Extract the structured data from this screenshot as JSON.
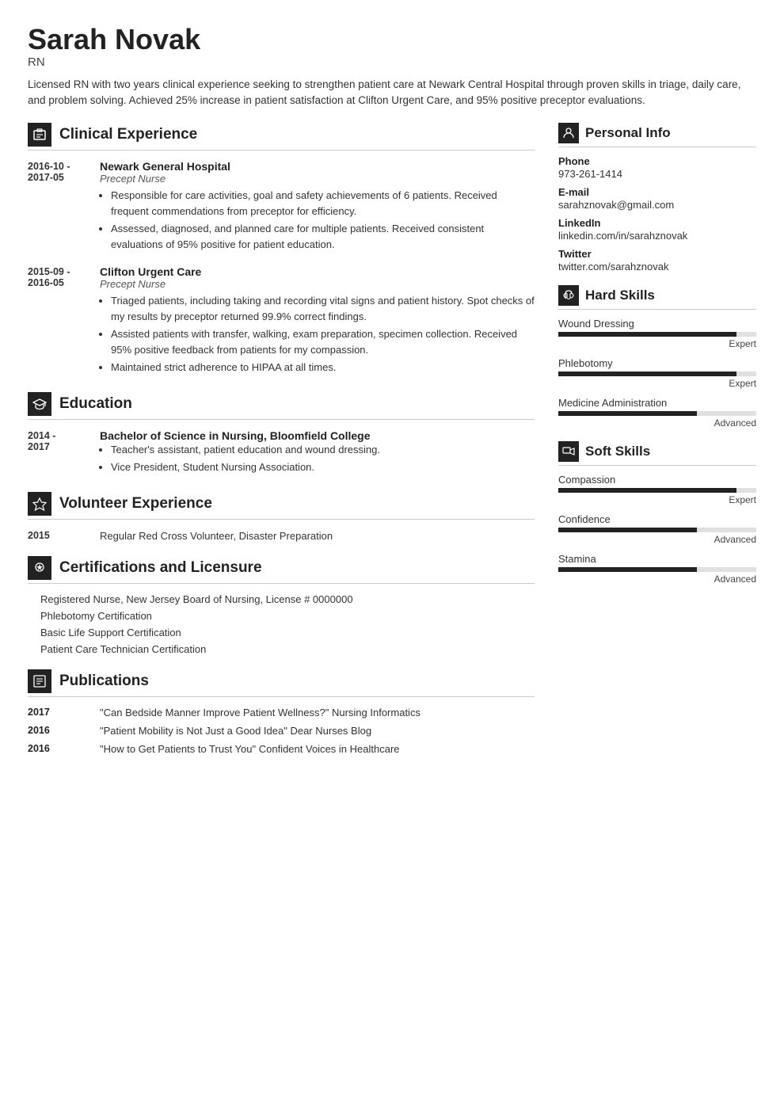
{
  "header": {
    "name": "Sarah Novak",
    "title": "RN",
    "summary": "Licensed RN with two years clinical experience seeking to strengthen patient care at Newark Central Hospital through proven skills in triage, daily care, and problem solving. Achieved 25% increase in patient satisfaction at Clifton Urgent Care, and 95% positive preceptor evaluations."
  },
  "sections": {
    "clinical_experience": {
      "label": "Clinical Experience",
      "entries": [
        {
          "date": "2016-10 -\n2017-05",
          "org": "Newark General Hospital",
          "role": "Precept Nurse",
          "bullets": [
            "Responsible for care activities, goal and safety achievements of 6 patients. Received frequent commendations from preceptor for efficiency.",
            "Assessed, diagnosed, and planned care for multiple patients. Received consistent evaluations of 95% positive for patient education."
          ]
        },
        {
          "date": "2015-09 -\n2016-05",
          "org": "Clifton Urgent Care",
          "role": "Precept Nurse",
          "bullets": [
            "Triaged patients, including taking and recording vital signs and patient history. Spot checks of my results by preceptor returned 99.9% correct findings.",
            "Assisted patients with transfer, walking, exam preparation, specimen collection. Received 95% positive feedback from patients for my compassion.",
            "Maintained strict adherence to HIPAA at all times."
          ]
        }
      ]
    },
    "education": {
      "label": "Education",
      "entries": [
        {
          "date": "2014 -\n2017",
          "org": "Bachelor of Science in Nursing, Bloomfield College",
          "role": "",
          "bullets": [
            "Teacher's assistant, patient education and wound dressing.",
            "Vice President, Student Nursing Association."
          ]
        }
      ]
    },
    "volunteer": {
      "label": "Volunteer Experience",
      "entries": [
        {
          "date": "2015",
          "text": "Regular Red Cross Volunteer, Disaster Preparation"
        }
      ]
    },
    "certifications": {
      "label": "Certifications and Licensure",
      "items": [
        "Registered Nurse, New Jersey Board of Nursing, License # 0000000",
        "Phlebotomy Certification",
        "Basic Life Support Certification",
        "Patient Care Technician Certification"
      ]
    },
    "publications": {
      "label": "Publications",
      "items": [
        {
          "year": "2017",
          "text": "\"Can Bedside Manner Improve Patient Wellness?\" Nursing Informatics"
        },
        {
          "year": "2016",
          "text": "\"Patient Mobility is Not Just a Good Idea\" Dear Nurses Blog"
        },
        {
          "year": "2016",
          "text": "\"How to Get Patients to Trust You\" Confident Voices in Healthcare"
        }
      ]
    }
  },
  "right": {
    "personal_info": {
      "label": "Personal Info",
      "fields": [
        {
          "label": "Phone",
          "value": "973-261-1414"
        },
        {
          "label": "E-mail",
          "value": "sarahznovak@gmail.com"
        },
        {
          "label": "LinkedIn",
          "value": "linkedin.com/in/sarahznovak"
        },
        {
          "label": "Twitter",
          "value": "twitter.com/sarahznovak"
        }
      ]
    },
    "hard_skills": {
      "label": "Hard Skills",
      "items": [
        {
          "name": "Wound Dressing",
          "level": "Expert",
          "pct": 90
        },
        {
          "name": "Phlebotomy",
          "level": "Expert",
          "pct": 90
        },
        {
          "name": "Medicine Administration",
          "level": "Advanced",
          "pct": 70
        }
      ]
    },
    "soft_skills": {
      "label": "Soft Skills",
      "items": [
        {
          "name": "Compassion",
          "level": "Expert",
          "pct": 90
        },
        {
          "name": "Confidence",
          "level": "Advanced",
          "pct": 70
        },
        {
          "name": "Stamina",
          "level": "Advanced",
          "pct": 70
        }
      ]
    }
  }
}
